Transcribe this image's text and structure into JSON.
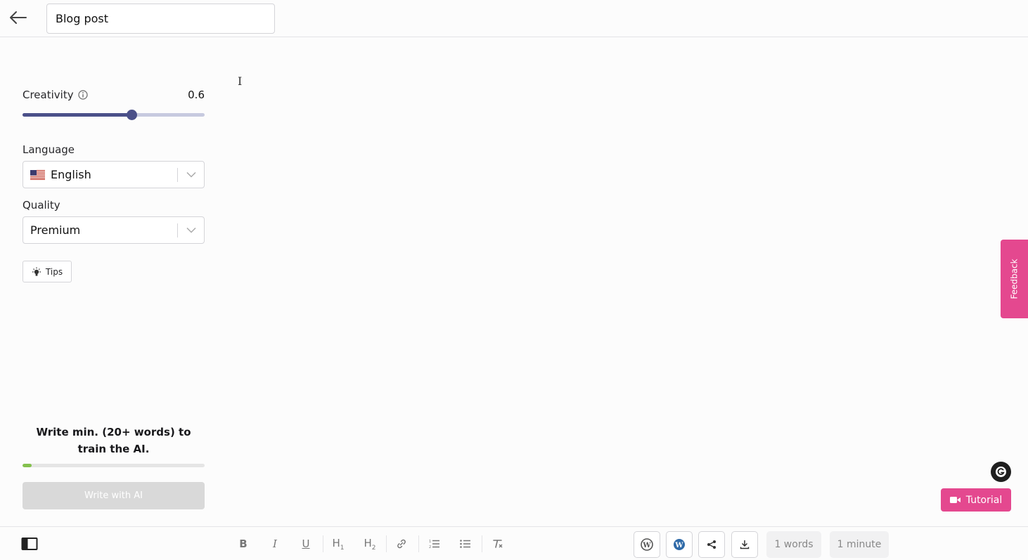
{
  "header": {
    "title_value": "Blog post"
  },
  "settings": {
    "creativity": {
      "label": "Creativity",
      "value_text": "0.6",
      "value": 0.6,
      "min": 0,
      "max": 1
    },
    "language": {
      "label": "Language",
      "selected": "English"
    },
    "quality": {
      "label": "Quality",
      "selected": "Premium"
    },
    "tips_label": "Tips"
  },
  "training": {
    "message": "Write min. (20+ words) to train the AI.",
    "progress_fraction": 0.05
  },
  "write_button_label": "Write with AI",
  "feedback_label": "Feedback",
  "tutorial_label": "Tutorial",
  "stats": {
    "words": "1 words",
    "reading_time": "1 minute"
  },
  "colors": {
    "accent_pink": "#e4488f",
    "slider": "#4b5089",
    "progress": "#84c14d"
  },
  "icons": {
    "back": "arrow-left-icon",
    "info": "info-icon",
    "flag": "us-flag-icon",
    "chevron": "chevron-down-icon",
    "tips": "lightbulb-icon",
    "grammarly": "grammarly-icon",
    "video": "video-camera-icon",
    "wordpress": "wordpress-icon",
    "share": "share-icon",
    "download": "download-icon"
  }
}
